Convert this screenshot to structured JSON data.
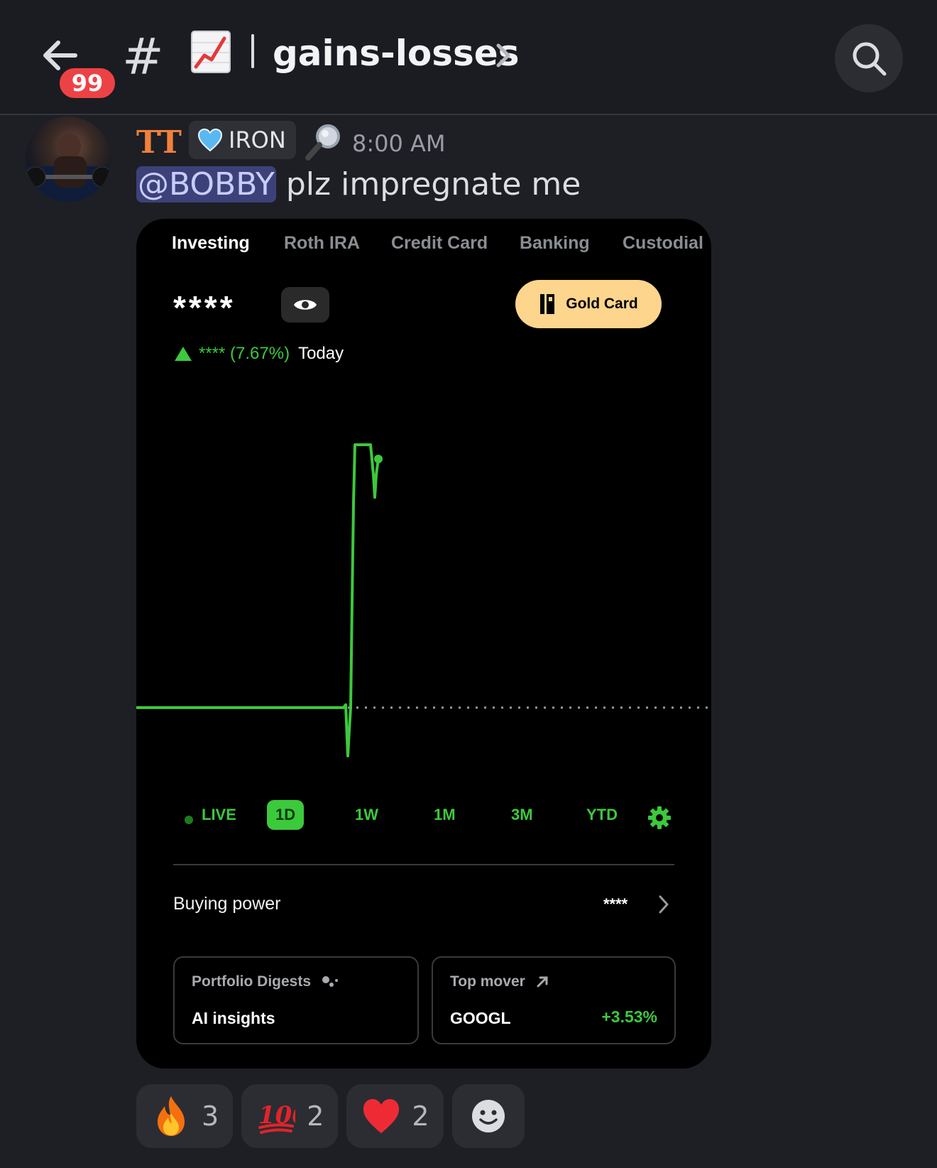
{
  "header": {
    "unread_count": "99",
    "hash_symbol": "#",
    "channel_emoji_icon": "chart-increasing-icon",
    "channel_name": "gains-losses"
  },
  "message": {
    "username": "TT",
    "role": "IRON",
    "role_icon": "blue-heart-icon",
    "status_emoji_icon": "magnifying-glass-icon",
    "timestamp": "8:00 AM",
    "mention": "@BOBBY",
    "text": " plz impregnate me"
  },
  "screenshot": {
    "tabs": [
      "Investing",
      "Roth IRA",
      "Credit Card",
      "Banking",
      "Custodial"
    ],
    "active_tab": "Investing",
    "balance_masked": "****",
    "gold_card_label": "Gold Card",
    "change_value": "**** (7.67%)",
    "change_period": "Today",
    "ranges": [
      "LIVE",
      "1D",
      "1W",
      "1M",
      "3M",
      "YTD"
    ],
    "selected_range": "1D",
    "buying_power_label": "Buying power",
    "buying_power_value": "****",
    "card_left": {
      "title": "Portfolio Digests",
      "main": "AI insights"
    },
    "card_right": {
      "title": "Top mover",
      "main": "GOOGL",
      "pct": "+3.53%"
    },
    "accent_color": "#3cc93c",
    "gold_color": "#fdd58d"
  },
  "reactions": [
    {
      "icon": "fire-icon",
      "count": "3"
    },
    {
      "icon": "hundred-points-icon",
      "count": "2"
    },
    {
      "icon": "red-heart-icon",
      "count": "2"
    }
  ]
}
